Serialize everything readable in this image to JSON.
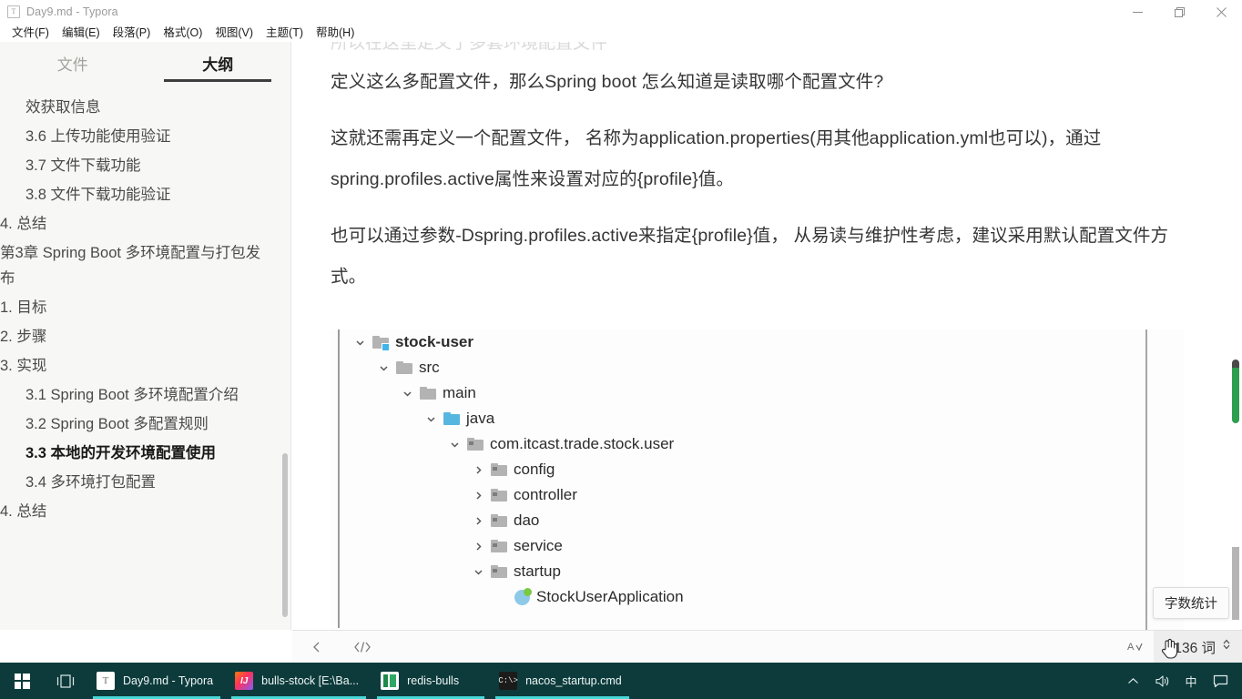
{
  "window": {
    "title": "Day9.md - Typora",
    "app_icon": "typora-icon",
    "minimize_label": "最小化",
    "maximize_label": "最大化",
    "close_label": "关闭"
  },
  "menubar": {
    "items": [
      {
        "label": "文件(F)",
        "name": "menu-file"
      },
      {
        "label": "编辑(E)",
        "name": "menu-edit"
      },
      {
        "label": "段落(P)",
        "name": "menu-paragraph"
      },
      {
        "label": "格式(O)",
        "name": "menu-format"
      },
      {
        "label": "视图(V)",
        "name": "menu-view"
      },
      {
        "label": "主题(T)",
        "name": "menu-theme"
      },
      {
        "label": "帮助(H)",
        "name": "menu-help"
      }
    ]
  },
  "sidebar": {
    "tabs": [
      {
        "label": "文件",
        "active": false
      },
      {
        "label": "大纲",
        "active": true
      }
    ],
    "outline": [
      {
        "label": "效获取信息",
        "level": 1,
        "active": false
      },
      {
        "label": "3.6 上传功能使用验证",
        "level": 1,
        "active": false
      },
      {
        "label": "3.7 文件下载功能",
        "level": 1,
        "active": false
      },
      {
        "label": "3.8 文件下载功能验证",
        "level": 1,
        "active": false
      },
      {
        "label": "4. 总结",
        "level": 0,
        "active": false
      },
      {
        "label": "第3章 Spring Boot 多环境配置与打包发布",
        "level": 0,
        "active": false
      },
      {
        "label": "1. 目标",
        "level": 0,
        "active": false
      },
      {
        "label": "2. 步骤",
        "level": 0,
        "active": false
      },
      {
        "label": "3. 实现",
        "level": 0,
        "active": false
      },
      {
        "label": "3.1 Spring Boot 多环境配置介绍",
        "level": 1,
        "active": false
      },
      {
        "label": "3.2 Spring Boot 多配置规则",
        "level": 1,
        "active": false
      },
      {
        "label": "3.3 本地的开发环境配置使用",
        "level": 1,
        "active": true
      },
      {
        "label": "3.4 多环境打包配置",
        "level": 1,
        "active": false
      },
      {
        "label": "4. 总结",
        "level": 0,
        "active": false
      }
    ]
  },
  "document": {
    "cut_off_line": "所以在这里定义了多套环境配置文件",
    "paragraphs": [
      "定义这么多配置文件，那么Spring boot 怎么知道是读取哪个配置文件?",
      "这就还需再定义一个配置文件， 名称为application.properties(用其他application.yml也可以)，通过spring.profiles.active属性来设置对应的{profile}值。",
      "也可以通过参数-Dspring.profiles.active来指定{profile}值， 从易读与维护性考虑，建议采用默认配置文件方式。"
    ],
    "heading": "3.3 本地的开发环境配置使用",
    "file_tree": [
      {
        "label": "stock-user",
        "indent": 0,
        "state": "expanded",
        "icon": "module-folder-icon",
        "bold": true
      },
      {
        "label": "src",
        "indent": 1,
        "state": "expanded",
        "icon": "folder-icon",
        "bold": false
      },
      {
        "label": "main",
        "indent": 2,
        "state": "expanded",
        "icon": "folder-icon",
        "bold": false
      },
      {
        "label": "java",
        "indent": 3,
        "state": "expanded",
        "icon": "source-folder-icon",
        "bold": false
      },
      {
        "label": "com.itcast.trade.stock.user",
        "indent": 4,
        "state": "expanded",
        "icon": "package-icon",
        "bold": false
      },
      {
        "label": "config",
        "indent": 5,
        "state": "collapsed",
        "icon": "package-icon",
        "bold": false
      },
      {
        "label": "controller",
        "indent": 5,
        "state": "collapsed",
        "icon": "package-icon",
        "bold": false
      },
      {
        "label": "dao",
        "indent": 5,
        "state": "collapsed",
        "icon": "package-icon",
        "bold": false
      },
      {
        "label": "service",
        "indent": 5,
        "state": "collapsed",
        "icon": "package-icon",
        "bold": false
      },
      {
        "label": "startup",
        "indent": 5,
        "state": "expanded",
        "icon": "package-icon",
        "bold": false
      },
      {
        "label": "StockUserApplication",
        "indent": 6,
        "state": "leaf",
        "icon": "spring-class-icon",
        "bold": false
      }
    ]
  },
  "statusbar": {
    "back_icon": "chevron-left-icon",
    "source_icon": "source-code-icon",
    "spellcheck_icon": "spellcheck-icon",
    "word_count": "9136 词",
    "stepper_icon": "chevron-updown-icon",
    "tooltip": "字数统计"
  },
  "taskbar": {
    "start_label": "开始",
    "search_label": "任务视图",
    "items": [
      {
        "label": "Day9.md - Typora",
        "icon": "typora",
        "glyph": "T"
      },
      {
        "label": "bulls-stock [E:\\Ba...",
        "icon": "idea",
        "glyph": "IJ"
      },
      {
        "label": "redis-bulls",
        "icon": "redis",
        "glyph": ""
      },
      {
        "label": "nacos_startup.cmd",
        "icon": "cmd",
        "glyph": "C:\\>"
      }
    ],
    "tray": [
      {
        "name": "show-hidden-icons",
        "glyph": "⌃"
      },
      {
        "name": "volume-icon",
        "glyph": "🔊"
      },
      {
        "name": "ime-icon",
        "glyph": "中"
      },
      {
        "name": "notification-icon",
        "glyph": "▭"
      }
    ]
  },
  "colors": {
    "taskbar_bg": "#0d3b3b",
    "taskbar_accent": "#46d8d8",
    "sidebar_bg": "#f7f7f5",
    "scroll_green": "#2e9e4f"
  }
}
